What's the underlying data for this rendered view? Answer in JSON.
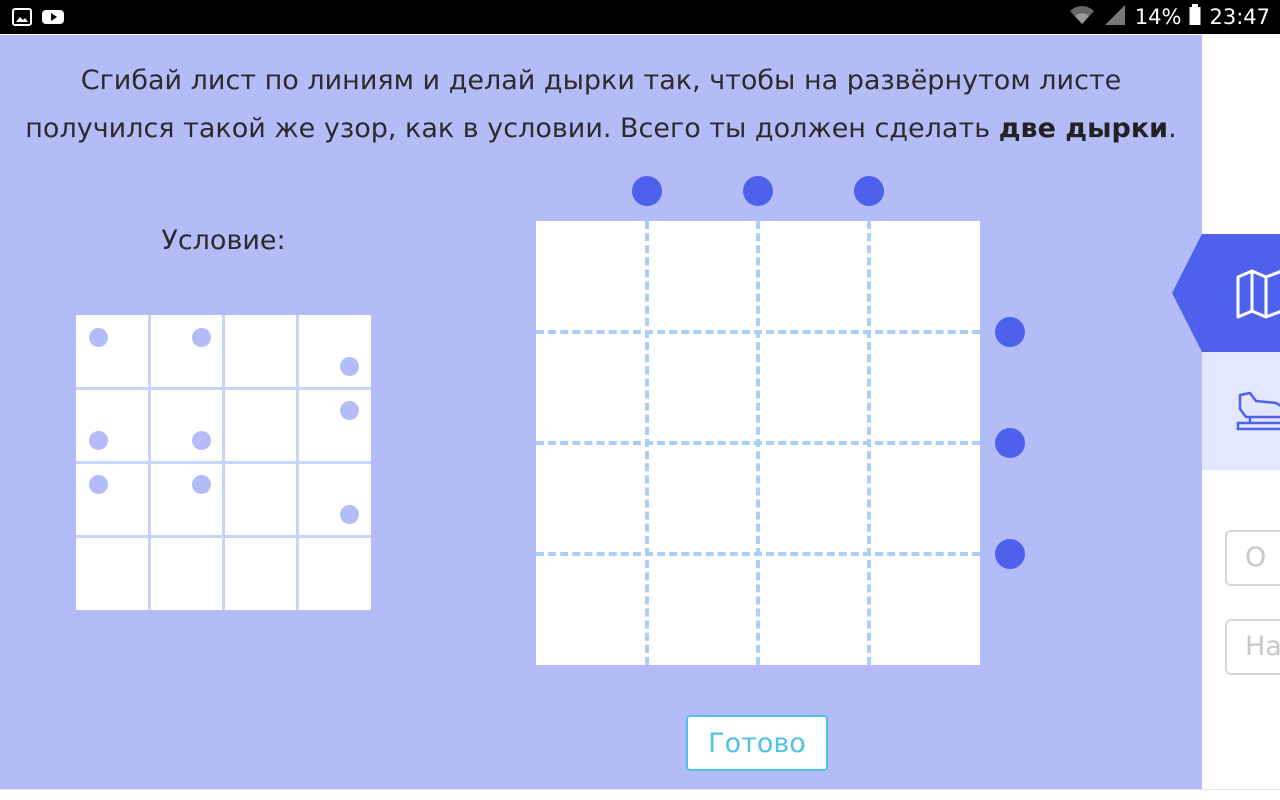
{
  "status_bar": {
    "left_icons": [
      "gallery-icon",
      "youtube-icon"
    ],
    "wifi_icon": "wifi-icon",
    "signal_icon": "signal-icon",
    "battery_percent": "14%",
    "battery_icon": "battery-icon",
    "time": "23:47"
  },
  "task": {
    "instruction_main": "Сгибай лист по линиям и делай дырки так, чтобы на развёрнутом листе получился такой же узор, как в условии. Всего ты должен сделать ",
    "instruction_bold": "две дырки",
    "instruction_end": "."
  },
  "condition": {
    "label": "Условие:",
    "grid_size": 4,
    "holes": [
      {
        "row": 0,
        "col": 0,
        "pos": "top-left"
      },
      {
        "row": 0,
        "col": 1,
        "pos": "top-right"
      },
      {
        "row": 0,
        "col": 3,
        "pos": "bottom-right"
      },
      {
        "row": 1,
        "col": 0,
        "pos": "bottom-left"
      },
      {
        "row": 1,
        "col": 1,
        "pos": "bottom-right"
      },
      {
        "row": 1,
        "col": 3,
        "pos": "top-right"
      },
      {
        "row": 2,
        "col": 0,
        "pos": "top-left"
      },
      {
        "row": 2,
        "col": 1,
        "pos": "top-right"
      },
      {
        "row": 2,
        "col": 3,
        "pos": "bottom-right"
      }
    ]
  },
  "sheet": {
    "grid_size": 4,
    "vertical_fold_count": 3,
    "horizontal_fold_count": 3
  },
  "buttons": {
    "done_label": "Готово"
  },
  "side_panel": {
    "map_tab_icon": "map-icon",
    "punch_tab_icon": "hole-punch-icon",
    "button1_label": "О",
    "button2_label": "На"
  },
  "colors": {
    "background": "#b4bcf8",
    "accent": "#4d61ec",
    "fold_line": "#a9cff7",
    "button_text": "#4fc1e9"
  }
}
